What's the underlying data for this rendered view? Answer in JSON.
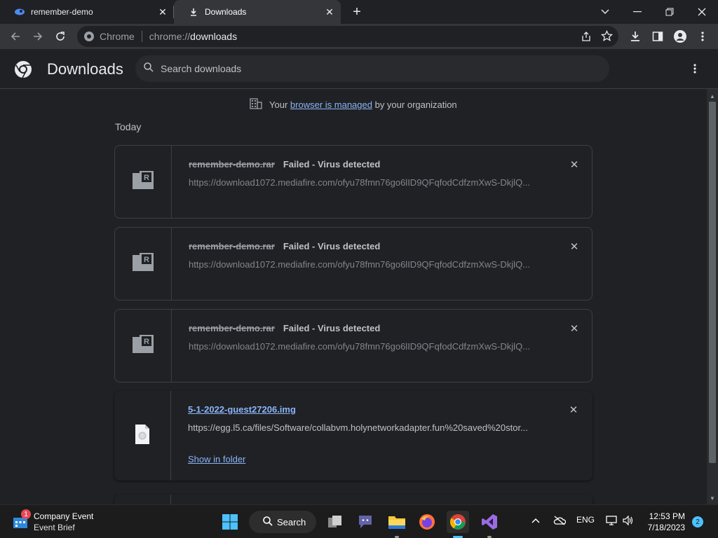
{
  "tabs": [
    {
      "title": "remember-demo",
      "icon": "app-icon"
    },
    {
      "title": "Downloads",
      "icon": "download-icon"
    }
  ],
  "toolbar": {
    "omnibox_label": "Chrome",
    "url_scheme": "chrome://",
    "url_path": "downloads"
  },
  "page": {
    "title": "Downloads",
    "search_placeholder": "Search downloads",
    "managed_prefix": "Your",
    "managed_link": "browser is managed",
    "managed_suffix": "by your organization",
    "section_label": "Today"
  },
  "downloads": [
    {
      "filename": "remember-demo.rar",
      "status": "Failed - Virus detected",
      "url": "https://download1072.mediafire.com/ofyu78fmn76go6lID9QFqfodCdfzmXwS-DkjlQ..."
    },
    {
      "filename": "remember-demo.rar",
      "status": "Failed - Virus detected",
      "url": "https://download1072.mediafire.com/ofyu78fmn76go6lID9QFqfodCdfzmXwS-DkjlQ..."
    },
    {
      "filename": "remember-demo.rar",
      "status": "Failed - Virus detected",
      "url": "https://download1072.mediafire.com/ofyu78fmn76go6lID9QFqfodCdfzmXwS-DkjlQ..."
    },
    {
      "filename": "5-1-2022-guest27206.img",
      "status": "",
      "url": "https://egg.l5.ca/files/Software/collabvm.holynetworkadapter.fun%20saved%20stor...",
      "action": "Show in folder"
    }
  ],
  "taskbar": {
    "widget_badge": "1",
    "widget_title": "Company Event",
    "widget_subtitle": "Event Brief",
    "search_label": "Search",
    "language": "ENG",
    "time": "12:53 PM",
    "date": "7/18/2023",
    "notification_count": "2"
  },
  "colors": {
    "accent": "#8ab4f8",
    "taskbar_accent": "#4cc2ff",
    "background": "#202124"
  }
}
